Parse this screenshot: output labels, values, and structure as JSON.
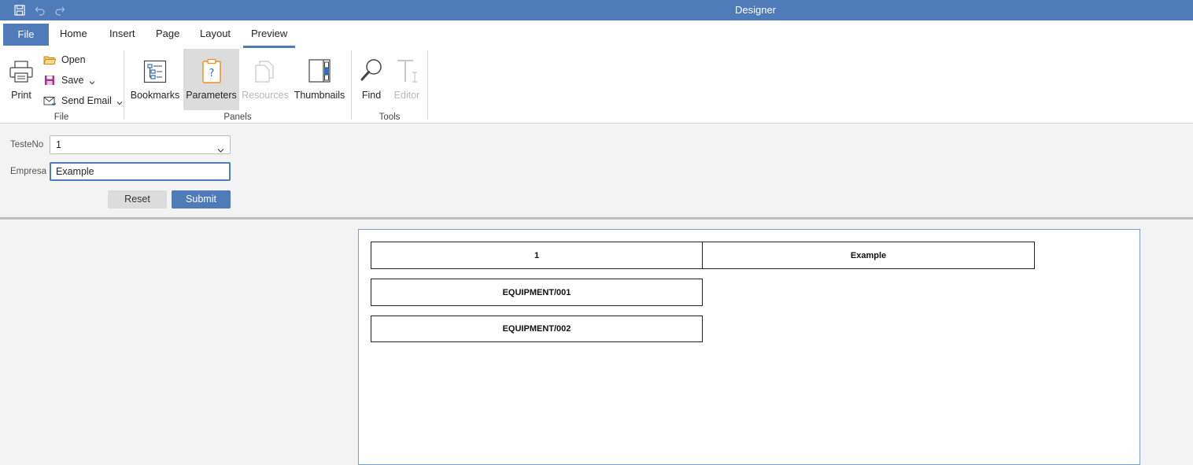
{
  "window": {
    "title": "Designer"
  },
  "quick_access": {
    "save_icon": "save-icon",
    "undo_icon": "undo-icon",
    "redo_icon": "redo-icon"
  },
  "tabs": [
    {
      "label": "File"
    },
    {
      "label": "Home"
    },
    {
      "label": "Insert"
    },
    {
      "label": "Page"
    },
    {
      "label": "Layout"
    },
    {
      "label": "Preview"
    }
  ],
  "active_tab": "Preview",
  "ribbon": {
    "file_group": {
      "label": "File",
      "print": "Print",
      "open": "Open",
      "save": "Save",
      "send_email": "Send Email"
    },
    "panels_group": {
      "label": "Panels",
      "bookmarks": "Bookmarks",
      "parameters": "Parameters",
      "resources": "Resources",
      "thumbnails": "Thumbnails"
    },
    "tools_group": {
      "label": "Tools",
      "find": "Find",
      "editor": "Editor"
    }
  },
  "parameters": {
    "teste_no": {
      "label": "TesteNo",
      "value": "1"
    },
    "empresa": {
      "label": "Empresa",
      "value": "Example"
    },
    "reset": "Reset",
    "submit": "Submit"
  },
  "report": {
    "header": [
      "1",
      "Example"
    ],
    "rows": [
      "EQUIPMENT/001",
      "EQUIPMENT/002"
    ]
  },
  "colors": {
    "accent": "#4f7cb9",
    "disabled": "#b8b8b8"
  }
}
